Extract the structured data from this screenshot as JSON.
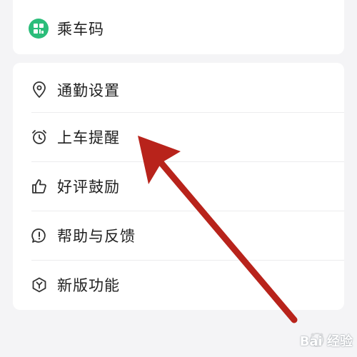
{
  "top_card": {
    "item": {
      "label": "乘车码",
      "icon": "qr-grid-icon"
    }
  },
  "menu": {
    "items": [
      {
        "label": "通勤设置",
        "icon": "location-pin-icon"
      },
      {
        "label": "上车提醒",
        "icon": "alarm-clock-icon"
      },
      {
        "label": "好评鼓励",
        "icon": "thumbs-up-icon"
      },
      {
        "label": "帮助与反馈",
        "icon": "chat-bubble-exclamation-icon"
      },
      {
        "label": "新版功能",
        "icon": "hexagon-y-icon"
      }
    ]
  },
  "annotation": {
    "arrow_color": "#b8231b"
  },
  "watermark": {
    "text": "Bai 经验"
  },
  "colors": {
    "background": "#f4f4f6",
    "card": "#ffffff",
    "badge_green": "#2bbd7a",
    "icon_stroke": "#333333"
  }
}
